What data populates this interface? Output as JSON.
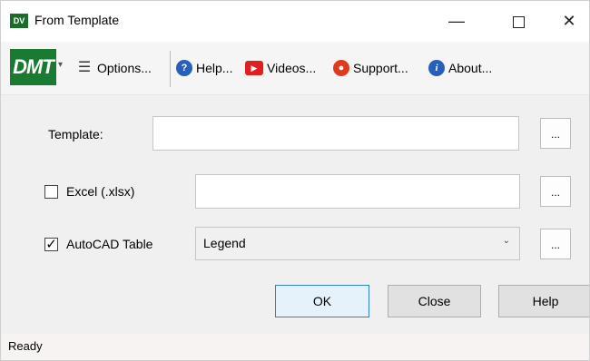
{
  "window": {
    "app_icon_text": "DV",
    "title": "From Template",
    "minimize_glyph": "—",
    "close_glyph": "✕"
  },
  "toolbar": {
    "logo_text": "DMT",
    "dropdown_glyph": "▾",
    "options_label": "Options...",
    "help_label": "Help...",
    "videos_label": "Videos...",
    "support_label": "Support...",
    "about_label": "About..."
  },
  "form": {
    "template_label": "Template:",
    "template_value": "",
    "excel_label": "Excel (.xlsx)",
    "excel_checked": false,
    "excel_value": "",
    "autocad_label": "AutoCAD Table",
    "autocad_checked": true,
    "check_glyph": "✓",
    "autocad_selected": "Legend",
    "browse_label": "..."
  },
  "buttons": {
    "ok": "OK",
    "close": "Close",
    "help": "Help"
  },
  "status": {
    "text": "Ready"
  }
}
